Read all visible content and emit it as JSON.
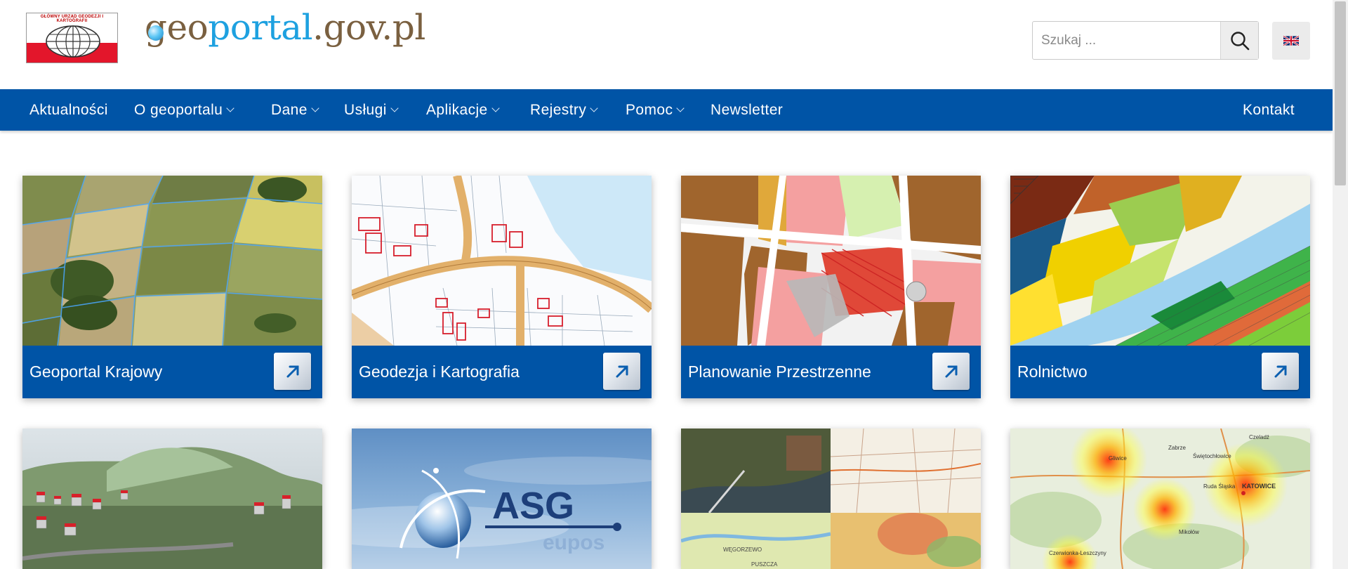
{
  "header": {
    "logo_text": "GŁÓWNY URZĄD GEODEZJI I KARTOGRAFII",
    "title_part1": "geo",
    "title_part2": "portal",
    "title_part3": ".gov.pl",
    "search_placeholder": "Szukaj ...",
    "search_icon": "search-icon",
    "language_icon": "uk-flag-icon"
  },
  "nav": {
    "items": [
      {
        "label": "Aktualności",
        "dropdown": false
      },
      {
        "label": "O geoportalu",
        "dropdown": true
      },
      {
        "label": "Dane",
        "dropdown": true
      },
      {
        "label": "Usługi",
        "dropdown": true
      },
      {
        "label": "Aplikacje",
        "dropdown": true
      },
      {
        "label": "Rejestry",
        "dropdown": true
      },
      {
        "label": "Pomoc",
        "dropdown": true
      },
      {
        "label": "Newsletter",
        "dropdown": false
      }
    ],
    "right_item": "Kontakt"
  },
  "tiles": [
    {
      "label": "Geoportal Krajowy"
    },
    {
      "label": "Geodezja i Kartografia"
    },
    {
      "label": "Planowanie Przestrzenne"
    },
    {
      "label": "Rolnictwo"
    }
  ],
  "tiles_row2": {
    "asg_logo_main": "ASG",
    "asg_logo_sub": "eupos",
    "map_label_1": "Gliwice",
    "map_label_2": "Zabrze",
    "map_label_3": "Świętochłowice",
    "map_label_4": "Czeladź",
    "map_label_5": "KATOWICE",
    "map_label_6": "Ruda Śląska",
    "map_label_7": "Mikołów",
    "map_label_8": "Czerwionka-Leszczyny",
    "map_label_9": "WĘGORZEWO",
    "map_label_10": "PUSZCZA"
  },
  "colors": {
    "nav_bg": "#0054a6",
    "tile_bar": "#0054a6",
    "title_brown": "#7a6040",
    "title_blue": "#1ea1e0"
  }
}
